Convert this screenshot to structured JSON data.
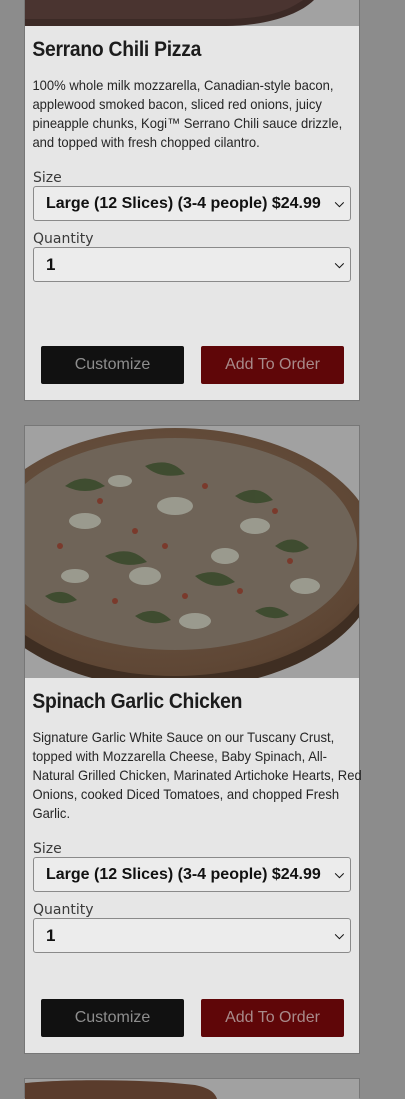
{
  "products": [
    {
      "title": "Serrano Chili Pizza",
      "description": "100% whole milk mozzarella, Canadian-style bacon, applewood smoked bacon, sliced red onions, juicy pineapple chunks, Kogi™ Serrano Chili sauce drizzle, and topped with fresh chopped cilantro.",
      "size_label": "Size",
      "size_value": "Large (12 Slices) (3-4 people) $24.99",
      "quantity_label": "Quantity",
      "quantity_value": "1",
      "customize_label": "Customize",
      "add_label": "Add To Order"
    },
    {
      "title": "Spinach Garlic Chicken",
      "description": "Signature Garlic White Sauce on our Tuscany Crust, topped with Mozzarella Cheese, Baby Spinach, All-Natural Grilled Chicken, Marinated Artichoke Hearts, Red Onions, cooked Diced Tomatoes, and chopped Fresh Garlic.",
      "size_label": "Size",
      "size_value": "Large (12 Slices) (3-4 people) $24.99",
      "quantity_label": "Quantity",
      "quantity_value": "1",
      "customize_label": "Customize",
      "add_label": "Add To Order"
    }
  ],
  "icons": {
    "select_arrow": "chevron-down-icon"
  },
  "colors": {
    "overlay": "#8c8c8c",
    "card": "#e6e6e6",
    "add_button": "#5f0608",
    "customize_button": "#111111"
  }
}
